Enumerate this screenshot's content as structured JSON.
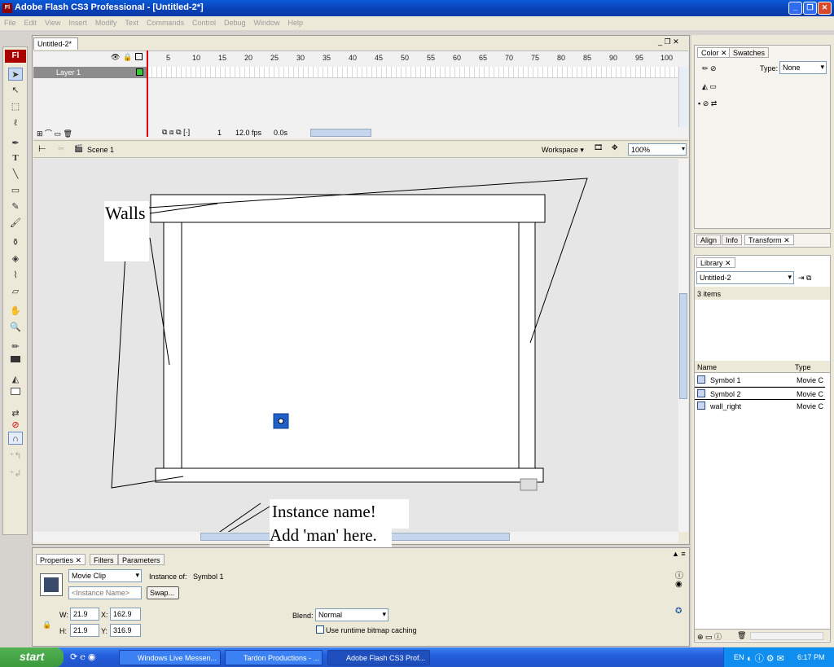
{
  "window": {
    "title": "Adobe Flash CS3 Professional - [Untitled-2*]",
    "app_icon": "Fl",
    "accent": "#0a3fb4"
  },
  "menu": [
    "File",
    "Edit",
    "View",
    "Insert",
    "Modify",
    "Text",
    "Commands",
    "Control",
    "Debug",
    "Window",
    "Help"
  ],
  "tools": {
    "logo": "Fl"
  },
  "document": {
    "tab": "Untitled-2*",
    "timeline": {
      "frame_numbers": [
        "5",
        "10",
        "15",
        "20",
        "25",
        "30",
        "35",
        "40",
        "45",
        "50",
        "55",
        "60",
        "65",
        "70",
        "75",
        "80",
        "85",
        "90",
        "95",
        "100"
      ],
      "layer_name": "Layer 1",
      "current_frame": "1",
      "frame_rate": "12.0 fps",
      "elapsed": "0.0s"
    },
    "edit_bar": {
      "scene": "Scene 1",
      "workspace": "Workspace ▾",
      "zoom": "100%"
    }
  },
  "annotations": {
    "walls": "Walls",
    "instance_line1": "Instance name!",
    "instance_line2": "Add 'man' here."
  },
  "properties": {
    "tabs": [
      "Properties",
      "Filters",
      "Parameters"
    ],
    "symbol_type": "Movie Clip",
    "instance_of_label": "Instance of:",
    "instance_of": "Symbol 1",
    "instance_name_placeholder": "<Instance Name>",
    "swap": "Swap...",
    "w_label": "W:",
    "w": "21.9",
    "h_label": "H:",
    "h": "21.9",
    "x_label": "X:",
    "x": "162.9",
    "y_label": "Y:",
    "y": "316.9",
    "blend_label": "Blend:",
    "blend": "Normal",
    "cache_label": "Use runtime bitmap caching"
  },
  "color_panel": {
    "tabs": [
      "Color",
      "Swatches"
    ],
    "type_label": "Type:",
    "type": "None"
  },
  "align_panel": {
    "tabs": [
      "Align",
      "Info",
      "Transform"
    ]
  },
  "library": {
    "tab": "Library",
    "document": "Untitled-2",
    "count": "3 items",
    "col_name": "Name",
    "col_type": "Type",
    "items": [
      {
        "name": "Symbol 1",
        "type": "Movie C"
      },
      {
        "name": "Symbol 2",
        "type": "Movie C"
      },
      {
        "name": "wall_right",
        "type": "Movie C"
      }
    ]
  },
  "taskbar": {
    "start": "start",
    "tasks": [
      "Windows Live Messen...",
      "Tardon Productions - ...",
      "Adobe Flash CS3 Prof..."
    ],
    "lang": "EN",
    "clock": "6:17 PM"
  }
}
